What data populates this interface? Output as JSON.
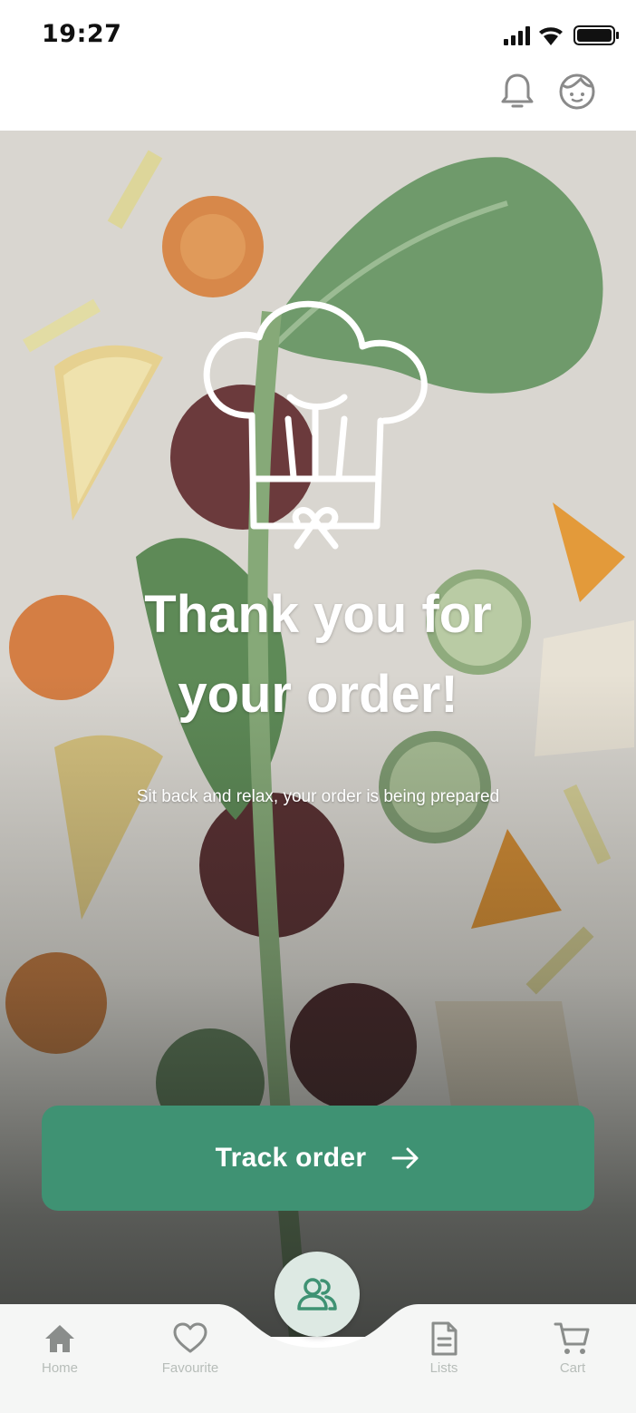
{
  "status_bar": {
    "time": "19:27",
    "signal_icon": "cellular-signal-icon",
    "wifi_icon": "wifi-icon",
    "battery_icon": "battery-icon"
  },
  "header": {
    "notifications_icon": "bell-icon",
    "profile_icon": "avatar-face-icon"
  },
  "confirmation": {
    "illustration_icon": "chef-hat-gift-icon",
    "title_line1": "Thank you for",
    "title_line2": "your order!",
    "subtitle": "Sit back and relax, your order is being prepared"
  },
  "actions": {
    "track_label": "Track order",
    "track_icon": "arrow-right-icon"
  },
  "bottom_nav": {
    "items": [
      {
        "label": "Home",
        "icon": "home-icon"
      },
      {
        "label": "Favourite",
        "icon": "heart-icon"
      },
      {
        "label": "Lists",
        "icon": "document-list-icon"
      },
      {
        "label": "Cart",
        "icon": "cart-icon"
      }
    ],
    "center_icon": "users-group-icon"
  },
  "colors": {
    "accent": "#3f9273",
    "nav_label": "#b7bdb9",
    "fab_bg": "#dde9e3"
  }
}
